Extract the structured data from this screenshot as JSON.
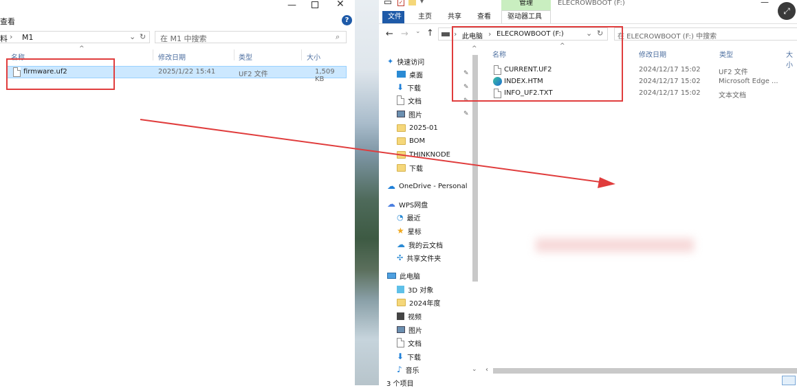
{
  "left": {
    "ribbon_partial": "查看",
    "breadcrumb_partial": "料",
    "breadcrumb_current": "M1",
    "search_placeholder": "在 M1 中搜索",
    "columns": [
      "名称",
      "修改日期",
      "类型",
      "大小"
    ],
    "file": {
      "name": "firmware.uf2",
      "date": "2025/1/22 15:41",
      "type": "UF2 文件",
      "size": "1,509 KB"
    }
  },
  "right": {
    "title": "ELECROWBOOT (F:)",
    "context_tab_group": "管理",
    "ribbon_tabs": [
      "文件",
      "主页",
      "共享",
      "查看",
      "驱动器工具"
    ],
    "breadcrumb": [
      "此电脑",
      "ELECROWBOOT (F:)"
    ],
    "search_placeholder": "在 ELECROWBOOT (F:) 中搜索",
    "columns": [
      "名称",
      "修改日期",
      "类型",
      "大小"
    ],
    "files": [
      {
        "name": "CURRENT.UF2",
        "date": "2024/12/17 15:02",
        "type": "UF2 文件",
        "icon": "file-icon"
      },
      {
        "name": "INDEX.HTM",
        "date": "2024/12/17 15:02",
        "type": "Microsoft Edge ...",
        "icon": "edge-icon"
      },
      {
        "name": "INFO_UF2.TXT",
        "date": "2024/12/17 15:02",
        "type": "文本文档",
        "icon": "text-file-icon"
      }
    ],
    "nav": {
      "quick_access": "快速访问",
      "quick_items": [
        "桌面",
        "下载",
        "文档",
        "图片",
        "2025-01",
        "BOM",
        "THINKNODE",
        "下载"
      ],
      "onedrive": "OneDrive - Personal",
      "wps": "WPS网盘",
      "wps_items": [
        "最近",
        "星标",
        "我的云文档",
        "共享文件夹"
      ],
      "this_pc": "此电脑",
      "pc_items": [
        "3D 对象",
        "2024年度",
        "视频",
        "图片",
        "文档",
        "下载",
        "音乐"
      ]
    },
    "status": "3 个项目"
  },
  "colors": {
    "accent": "#1e5aa8",
    "highlight": "#cce8ff",
    "annotation_red": "#e03c3c",
    "manage_tab": "#c9eec0"
  }
}
